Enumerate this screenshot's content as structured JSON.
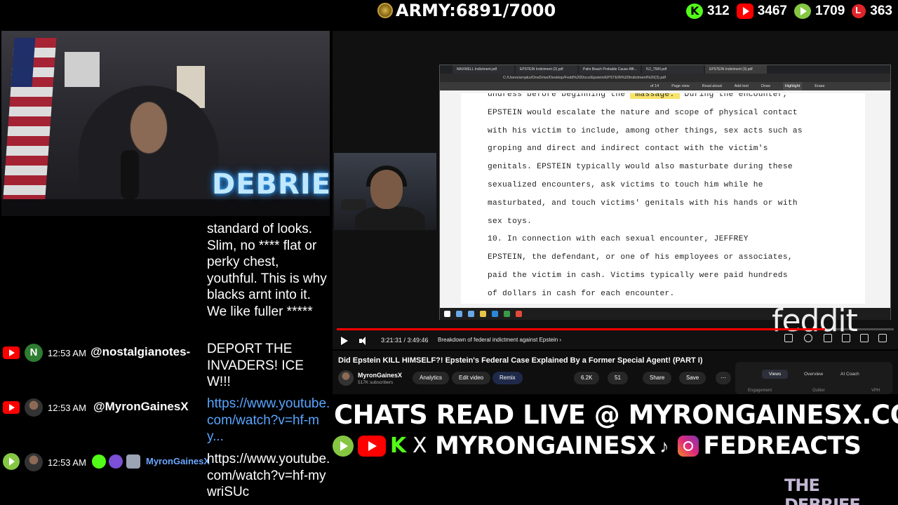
{
  "header": {
    "army_label": "ARMY:6891/7000",
    "stats": [
      {
        "platform": "kick",
        "icon": "kick-icon",
        "value": "312"
      },
      {
        "platform": "youtube",
        "icon": "youtube-icon",
        "value": "3467"
      },
      {
        "platform": "rumble",
        "icon": "rumble-icon",
        "value": "1709"
      },
      {
        "platform": "local",
        "icon": "local-icon",
        "value": "363"
      }
    ]
  },
  "webcam": {
    "neon_sign": "DEBRIEF"
  },
  "chat": {
    "messages": [
      {
        "text": "standard of looks. Slim, no **** flat or perky chest, youthful. This is why blacks arnt into it. We like fuller *****"
      },
      {
        "platform": "youtube",
        "avatar_letter": "N",
        "time": "12:53 AM",
        "user": "@nostalgianotes-",
        "text": "DEPORT THE INVADERS! ICE W!!!"
      },
      {
        "platform": "youtube",
        "time": "12:53 AM",
        "user": "@MyronGainesX",
        "text": "https://www.youtube.com/watch?v=hf-my..."
      },
      {
        "platform": "rumble",
        "time": "12:53 AM",
        "user": "MyronGainesX",
        "text": "https://www.youtube.com/watch?v=hf-mywriSUc"
      }
    ]
  },
  "browser": {
    "tabs": [
      "MAXWELL Indictment.pdf",
      "EPSTEIN Indictment (2).pdf",
      "Palm Beach Probable Cause Affi...",
      "f12_7580.pdf",
      "EPSTEIN Indictment (3).pdf"
    ],
    "address": "C:/Users/arnpku/OneDrive/Desktop/Fedd%20Docs/Epstein/EPSTEIN%20Indictment%20(3).pdf",
    "toolbar": {
      "page": "of 14",
      "page_view": "Page view",
      "read_aloud": "Read aloud",
      "add_text": "Add text",
      "draw": "Draw",
      "highlight": "Highlight",
      "erase": "Erase"
    },
    "pdf_lines": [
      {
        "pre": "undress before beginning the ",
        "hl": "\"massage.\"",
        "post": "  During the encounter,"
      },
      {
        "pre": "EPSTEIN would escalate the nature and scope of physical contact",
        "hl": "",
        "post": ""
      },
      {
        "pre": "with his victim to include, among other things, sex acts such as",
        "hl": "",
        "post": ""
      },
      {
        "pre": "groping and direct and indirect contact with the victim's",
        "hl": "",
        "post": ""
      },
      {
        "pre": "genitals.  EPSTEIN typically would also masturbate during these",
        "hl": "",
        "post": ""
      },
      {
        "pre": "sexualized encounters, ask victims to touch him while he",
        "hl": "",
        "post": ""
      },
      {
        "pre": "masturbated, and touch victims' genitals with his hands or with",
        "hl": "",
        "post": ""
      },
      {
        "pre": "sex toys.",
        "hl": "",
        "post": ""
      },
      {
        "pre": "        10.  In connection with each sexual encounter, JEFFREY",
        "hl": "",
        "post": ""
      },
      {
        "pre": "EPSTEIN, the defendant, or one of his employees or associates,",
        "hl": "",
        "post": ""
      },
      {
        "pre": "paid the victim in cash.  Victims typically were paid hundreds",
        "hl": "",
        "post": ""
      },
      {
        "pre": "of dollars in cash for each encounter.",
        "hl": "",
        "post": ""
      }
    ]
  },
  "player": {
    "time": "3:21:31 / 3:49:46",
    "chapter": "Breakdown of federal indictment against Epstein ›",
    "progress": 0.876,
    "watermark": "feddit"
  },
  "video_info": {
    "title": "Did Epstein KILL HIMSELF?! Epstein's Federal Case Explained By a Former Special Agent! (PART I)",
    "channel": "MyronGainesX",
    "subscribers": "517K subscribers",
    "buttons": {
      "analytics": "Analytics",
      "edit": "Edit video",
      "remix": "Remix",
      "likes": "6.2K",
      "dislikes": "51",
      "share": "Share",
      "save": "Save"
    },
    "studio_tabs": {
      "views": "Views",
      "overview": "Overview",
      "ai_coach": "AI Coach"
    },
    "studio_cols": {
      "engagement": "Engagement",
      "outlier": "Outlier",
      "vph": "VPH"
    }
  },
  "promo": {
    "line1": "CHATS READ LIVE @ MYRONGAINESX.COM",
    "handle1": "MYRONGAINESX",
    "handle2": "FEDREACTS",
    "brand": "THE DEBRIEF"
  },
  "colors": {
    "youtube": "#ff0000",
    "kick": "#53fc18",
    "rumble": "#85c742",
    "link": "#58a6ff",
    "progress": "#ff0000"
  }
}
